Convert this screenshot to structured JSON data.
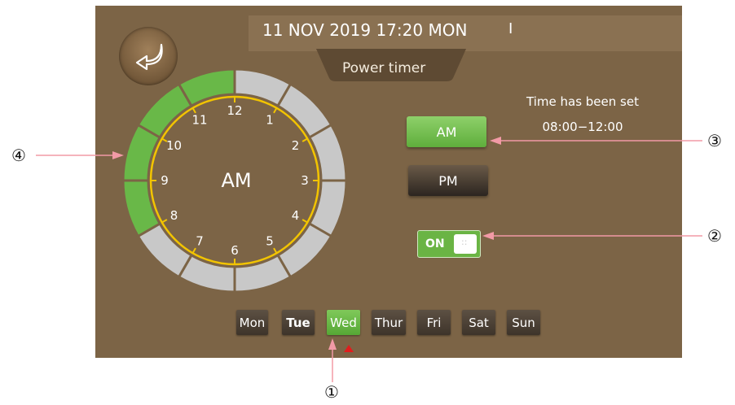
{
  "header": {
    "datetime": "11 NOV 2019 17:20 MON",
    "cursor_mark": "I",
    "title": "Power timer"
  },
  "back_button": {
    "icon": "back-arrow-icon"
  },
  "clock": {
    "center_label": "AM",
    "numbers": [
      "12",
      "1",
      "2",
      "3",
      "4",
      "5",
      "6",
      "7",
      "8",
      "9",
      "10",
      "11"
    ],
    "ring_colors": {
      "active": "#69b848",
      "inactive": "#c8c8c8"
    },
    "active_segments": [
      "8-9",
      "9-10",
      "10-11",
      "11-12"
    ],
    "face_ring_color": "#f2c400"
  },
  "status": {
    "title": "Time has been set",
    "range": "08:00−12:00"
  },
  "buttons": {
    "am": "AM",
    "pm": "PM"
  },
  "toggle": {
    "label": "ON",
    "state": "on",
    "knob_glyph": "::"
  },
  "days": [
    {
      "label": "Mon",
      "selected": false
    },
    {
      "label": "Tue",
      "selected": false
    },
    {
      "label": "Wed",
      "selected": true
    },
    {
      "label": "Thur",
      "selected": false
    },
    {
      "label": "Fri",
      "selected": false
    },
    {
      "label": "Sat",
      "selected": false
    },
    {
      "label": "Sun",
      "selected": false
    }
  ],
  "callouts": {
    "c1": "①",
    "c2": "②",
    "c3": "③",
    "c4": "④"
  },
  "colors": {
    "panel": "#7c6446",
    "accent_green": "#69b848",
    "callout_line": "#f29aa6"
  }
}
